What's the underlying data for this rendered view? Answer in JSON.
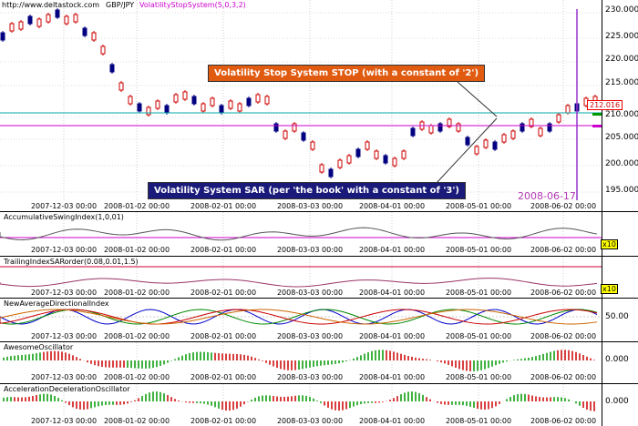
{
  "header": {
    "site": "http://www.deltastock.com",
    "symbol": "GBP/JPY",
    "indicator": "VolatilityStopSystem(5,0,3,2)"
  },
  "price_axis": [
    "230.000",
    "225.000",
    "220.000",
    "215.000",
    "210.000",
    "205.000",
    "200.000",
    "195.000"
  ],
  "current_price": "212.016",
  "date_labels": [
    "2007-12-03 00:00",
    "2008-01-02 00:00",
    "2008-02-01 00:00",
    "2008-03-03 00:00",
    "2008-04-01 00:00",
    "2008-05-01 00:00",
    "2008-06-02 00:00"
  ],
  "highlight_date": "2008-06-17",
  "callouts": {
    "stop": "Volatility Stop System STOP (with a constant of '2')",
    "sar": "Volatility System SAR (per 'the book' with a constant of '3')"
  },
  "panes": {
    "asi": {
      "title": "AccumulativeSwingIndex(1,0,01)",
      "badge": "x10"
    },
    "tis": {
      "title": "TrailingIndexSARorder(0.08,0.01,1.5)",
      "badge": "x10"
    },
    "adx": {
      "title": "NewAverageDirectionalIndex",
      "level": "50.00"
    },
    "ao": {
      "title": "AwesomeOscillator",
      "level": "0.000"
    },
    "ac": {
      "title": "AccelerationDecelerationOscillator",
      "level": "0.000"
    }
  },
  "colors": {
    "bull": "#cc0000",
    "bear": "#000080",
    "stop_line": "#cc00cc",
    "sar_line": "#00aaaa",
    "vline": "#9933cc",
    "callout_stop_bg": "#e05a10",
    "callout_sar_bg": "#1a1a7a"
  }
}
